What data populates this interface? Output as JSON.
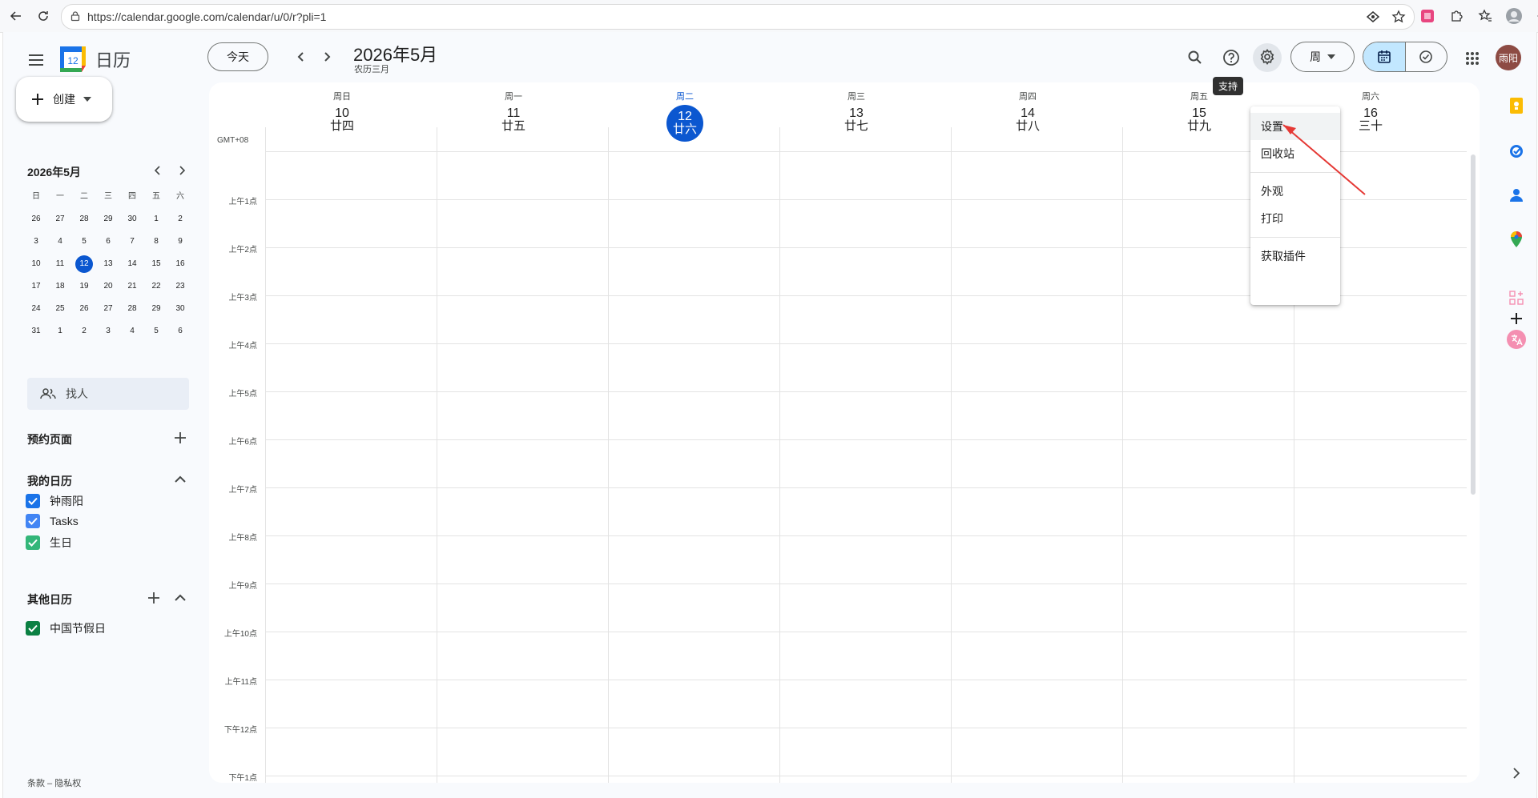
{
  "browser": {
    "url": "https://calendar.google.com/calendar/u/0/r?pli=1"
  },
  "header": {
    "app_title": "日历",
    "logo_day": "12",
    "today_label": "今天",
    "date_title": "2026年5月",
    "date_sub": "农历三月",
    "view_label": "周",
    "avatar_text": "雨阳",
    "tooltip": "支持"
  },
  "sidebar": {
    "create_label": "创建",
    "mini_title": "2026年5月",
    "weekdays": [
      "日",
      "一",
      "二",
      "三",
      "四",
      "五",
      "六"
    ],
    "weeks": [
      [
        "26",
        "27",
        "28",
        "29",
        "30",
        "1",
        "2"
      ],
      [
        "3",
        "4",
        "5",
        "6",
        "7",
        "8",
        "9"
      ],
      [
        "10",
        "11",
        "12",
        "13",
        "14",
        "15",
        "16"
      ],
      [
        "17",
        "18",
        "19",
        "20",
        "21",
        "22",
        "23"
      ],
      [
        "24",
        "25",
        "26",
        "27",
        "28",
        "29",
        "30"
      ],
      [
        "31",
        "1",
        "2",
        "3",
        "4",
        "5",
        "6"
      ]
    ],
    "today_date": "12",
    "find_people": "找人",
    "booking_title": "预约页面",
    "my_cal_title": "我的日历",
    "my_cals": [
      {
        "label": "钟雨阳",
        "color": "#1a73e8"
      },
      {
        "label": "Tasks",
        "color": "#4285f4"
      },
      {
        "label": "生日",
        "color": "#33b679"
      }
    ],
    "other_cal_title": "其他日历",
    "other_cals": [
      {
        "label": "中国节假日",
        "color": "#0b8043"
      }
    ],
    "footer": "条款 – 隐私权"
  },
  "week": {
    "gmt": "GMT+08",
    "days": [
      {
        "name": "周日",
        "num": "10",
        "lunar": "廿四"
      },
      {
        "name": "周一",
        "num": "11",
        "lunar": "廿五"
      },
      {
        "name": "周二",
        "num": "12",
        "lunar": "廿六",
        "today": true
      },
      {
        "name": "周三",
        "num": "13",
        "lunar": "廿七"
      },
      {
        "name": "周四",
        "num": "14",
        "lunar": "廿八"
      },
      {
        "name": "周五",
        "num": "15",
        "lunar": "廿九"
      },
      {
        "name": "周六",
        "num": "16",
        "lunar": "三十"
      }
    ],
    "hours": [
      "上午1点",
      "上午2点",
      "上午3点",
      "上午4点",
      "上午5点",
      "上午6点",
      "上午7点",
      "上午8点",
      "上午9点",
      "上午10点",
      "上午11点",
      "下午12点",
      "下午1点"
    ]
  },
  "settings_menu": {
    "items": [
      "设置",
      "回收站",
      "外观",
      "打印",
      "获取插件"
    ]
  },
  "colors": {
    "accent": "#0b57d0",
    "annotation": "#e53935"
  }
}
